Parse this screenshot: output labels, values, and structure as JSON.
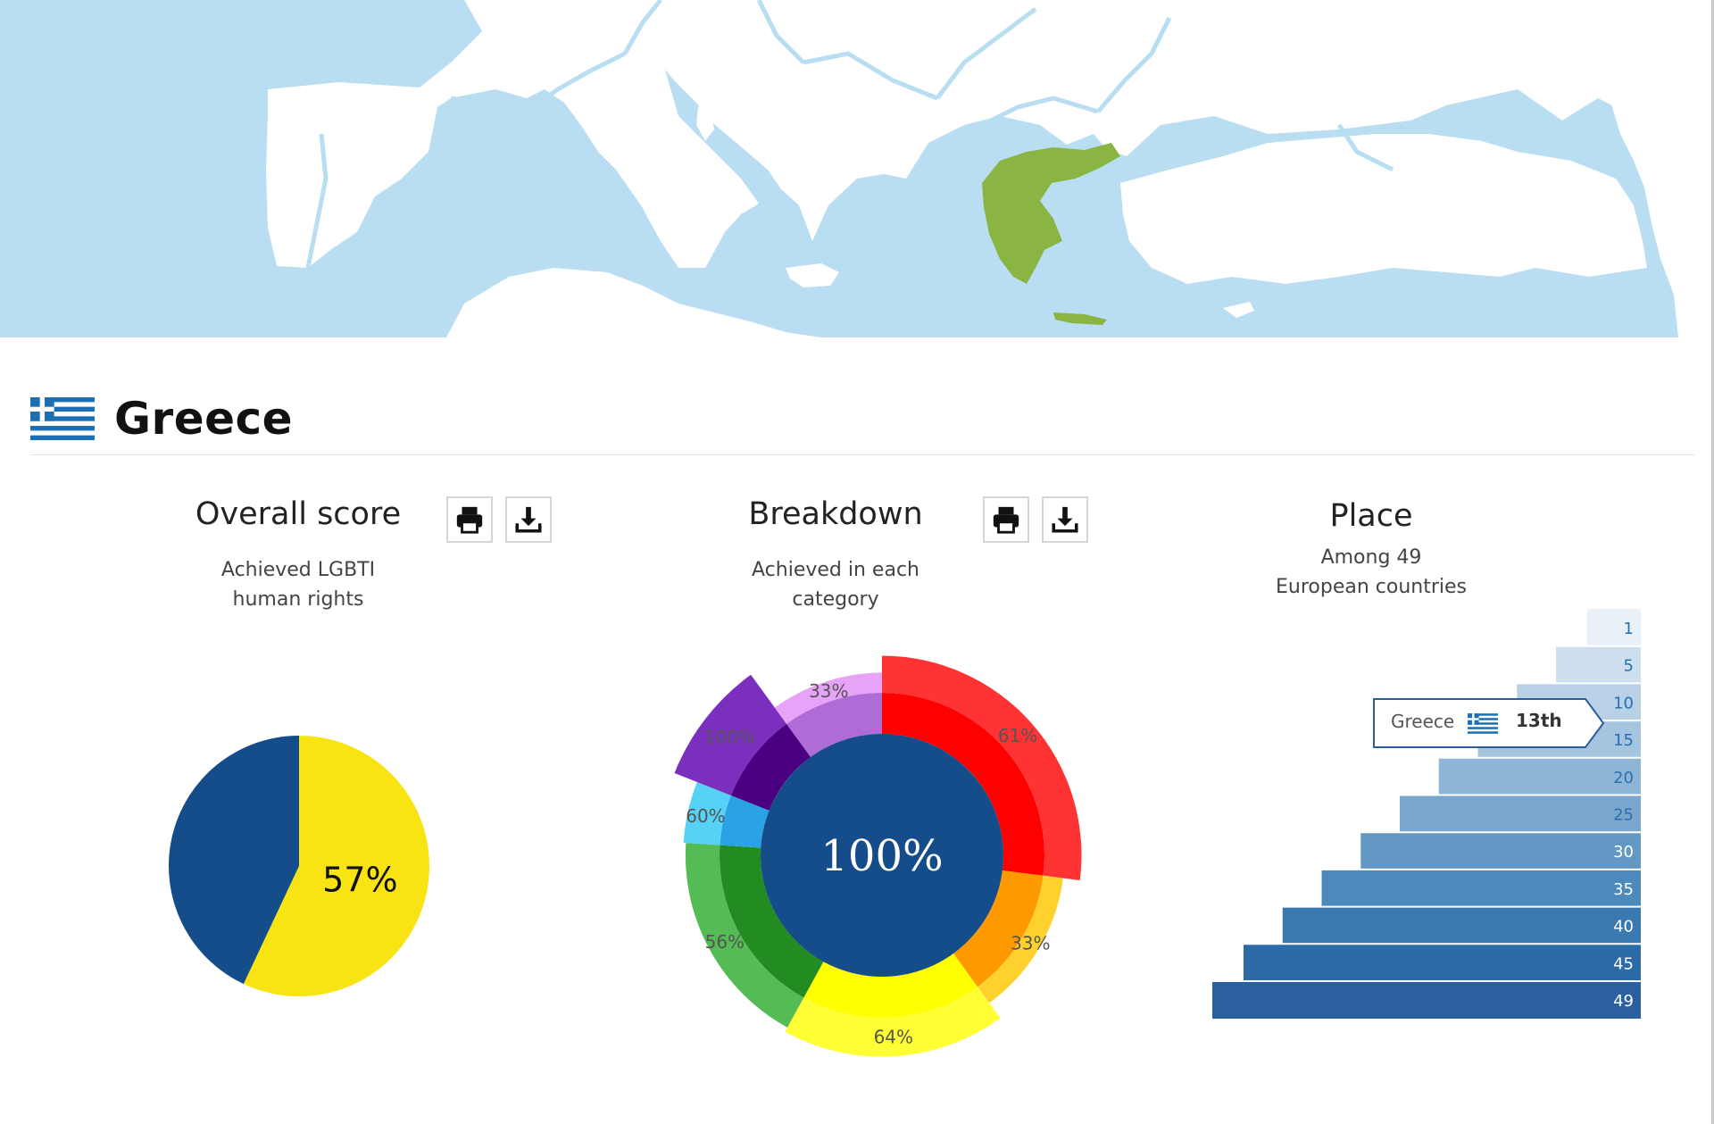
{
  "country": {
    "name": "Greece",
    "flag_icon": "greece-flag-icon"
  },
  "colors": {
    "sea": "#b9def2",
    "land": "#ffffff",
    "border": "#b9def2",
    "highlight": "#8ab543",
    "navy": "#154c8a",
    "yellow": "#f8e412"
  },
  "panels": {
    "overall": {
      "title": "Overall score",
      "subtitle_line1": "Achieved LGBTI",
      "subtitle_line2": "human rights"
    },
    "breakdown": {
      "title": "Breakdown",
      "subtitle_line1": "Achieved in each",
      "subtitle_line2": "category"
    },
    "place": {
      "title": "Place",
      "subtitle_line1": "Among 49",
      "subtitle_line2": "European countries"
    }
  },
  "buttons": {
    "print_icon": "printer-icon",
    "download_icon": "download-icon"
  },
  "tooltip": {
    "name": "Greece",
    "rank": "13th"
  },
  "chart_data": [
    {
      "type": "pie",
      "slices": [
        {
          "value": 57,
          "color": "#f8e412",
          "label": "57%"
        },
        {
          "value": 43,
          "color": "#154c8a",
          "label": ""
        }
      ]
    },
    {
      "type": "sunburst",
      "center_label": "100%",
      "center_color": "#154c8a",
      "categories": [
        {
          "color": "#ff0000",
          "outer_color": "#ff3333",
          "weight": 27,
          "value": 61,
          "label": "61%"
        },
        {
          "color": "#ff9900",
          "outer_color": "#ffd12e",
          "weight": 13,
          "value": 33,
          "label": "33%"
        },
        {
          "color": "#ffff00",
          "outer_color": "#ffff33",
          "weight": 18,
          "value": 64,
          "label": "64%"
        },
        {
          "color": "#228b22",
          "outer_color": "#55bb55",
          "weight": 18,
          "value": 56,
          "label": "56%"
        },
        {
          "color": "#29a3e6",
          "outer_color": "#55d2f5",
          "weight": 5,
          "value": 60,
          "label": "60%"
        },
        {
          "color": "#4b0082",
          "outer_color": "#7b2fbf",
          "weight": 9,
          "value": 100,
          "label": "100%"
        },
        {
          "color": "#b06cd6",
          "outer_color": "#e7a3f8",
          "weight": 10,
          "value": 33,
          "label": "33%"
        }
      ]
    },
    {
      "type": "bar",
      "orientation": "horizontal",
      "categories": [
        "1",
        "5",
        "10",
        "15",
        "20",
        "25",
        "30",
        "35",
        "40",
        "45",
        "49"
      ],
      "values": [
        1,
        5,
        10,
        15,
        20,
        25,
        30,
        35,
        40,
        45,
        49
      ],
      "xlim": [
        0,
        49
      ],
      "highlight": {
        "label": "Greece",
        "rank": 13
      }
    }
  ]
}
